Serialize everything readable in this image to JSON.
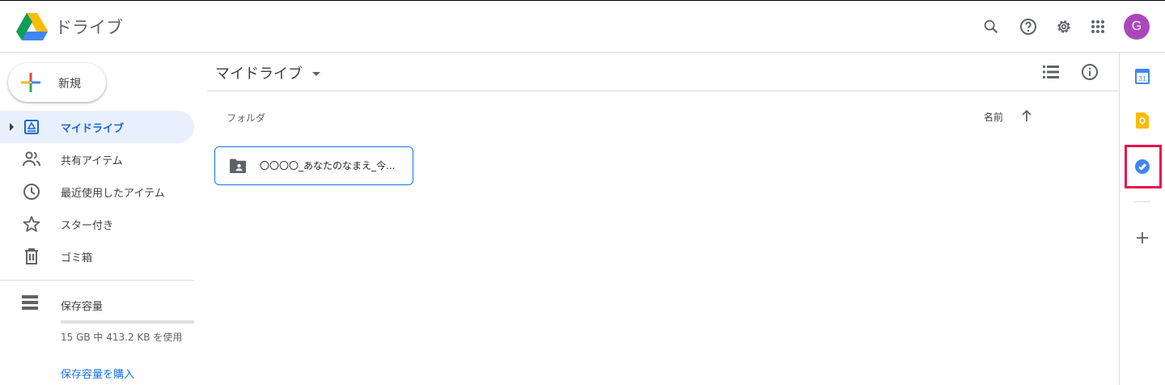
{
  "header": {
    "app_title": "ドライブ",
    "avatar_letter": "G",
    "icons": [
      "search-icon",
      "help-icon",
      "settings-icon",
      "apps-grid-icon"
    ]
  },
  "sidebar": {
    "new_label": "新規",
    "items": [
      {
        "label": "マイドライブ",
        "icon": "my-drive-icon",
        "active": true
      },
      {
        "label": "共有アイテム",
        "icon": "shared-people-icon",
        "active": false
      },
      {
        "label": "最近使用したアイテム",
        "icon": "clock-icon",
        "active": false
      },
      {
        "label": "スター付き",
        "icon": "star-icon",
        "active": false
      },
      {
        "label": "ゴミ箱",
        "icon": "trash-icon",
        "active": false
      }
    ],
    "storage": {
      "label": "保存容量",
      "usage_text": "15 GB 中 413.2 KB を使用",
      "buy_label": "保存容量を購入",
      "used_fraction": 3e-05
    }
  },
  "main": {
    "title": "マイドライブ",
    "section_label": "フォルダ",
    "sort_label": "名前",
    "folders": [
      {
        "name": "〇〇〇〇_あなたのなまえ_今..."
      }
    ]
  },
  "side_panel": {
    "icons": [
      "calendar-icon",
      "keep-icon",
      "tasks-icon",
      "add-addon-icon"
    ],
    "calendar_day": "31",
    "highlight_color": "#e6144d"
  },
  "colors": {
    "accent": "#1a73e8",
    "active_bg": "#e8f0fe",
    "active_text": "#1967d2"
  }
}
